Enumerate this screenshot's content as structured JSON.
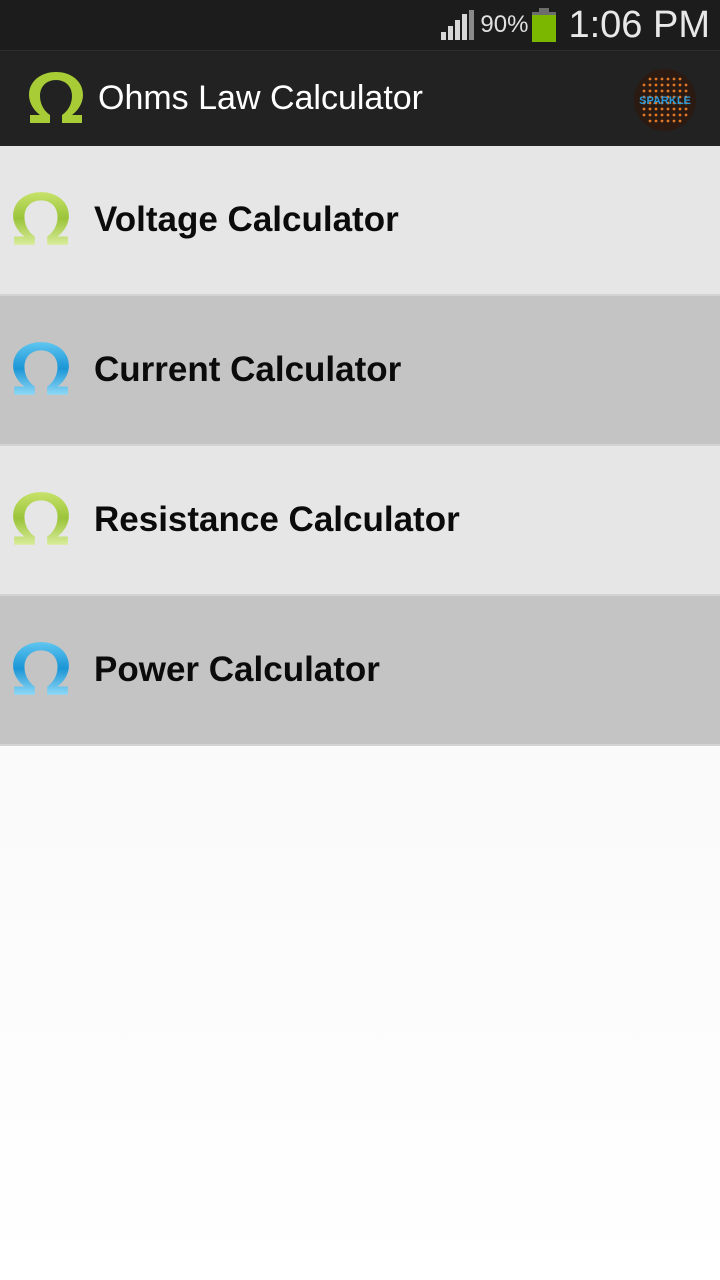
{
  "status_bar": {
    "battery_percent": "90%",
    "battery_level": 0.9,
    "signal_bars": 4,
    "time": "1:06 PM"
  },
  "action_bar": {
    "title": "Ohms Law Calculator",
    "app_icon": "omega-icon",
    "brand_logo_text": "SPARKLE",
    "colors": {
      "background": "#222222",
      "icon": "#a8cc36"
    }
  },
  "menu": {
    "items": [
      {
        "label": "Voltage Calculator",
        "icon": "omega-green-icon",
        "icon_color": "#9bc43a"
      },
      {
        "label": "Current Calculator",
        "icon": "omega-blue-icon",
        "icon_color": "#2aa6e0"
      },
      {
        "label": "Resistance Calculator",
        "icon": "omega-green-icon",
        "icon_color": "#9bc43a"
      },
      {
        "label": "Power Calculator",
        "icon": "omega-blue-icon",
        "icon_color": "#2aa6e0"
      }
    ]
  }
}
